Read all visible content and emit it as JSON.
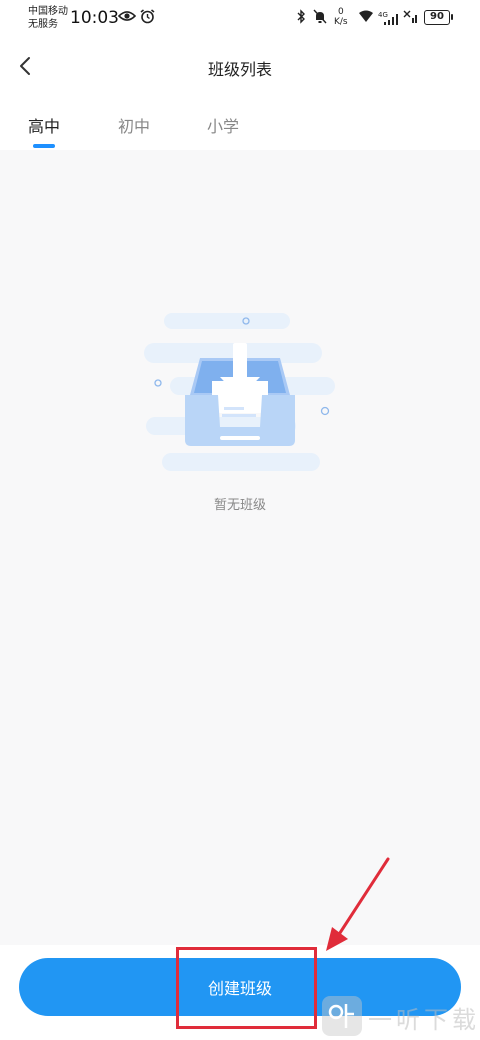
{
  "status_bar": {
    "carrier_line1": "中国移动",
    "carrier_line2": "无服务",
    "time": "10:03",
    "net_speed_value": "0",
    "net_speed_unit": "K/s",
    "network_type": "4G",
    "battery": "90"
  },
  "nav": {
    "title": "班级列表"
  },
  "tabs": [
    {
      "label": "高中",
      "active": true
    },
    {
      "label": "初中",
      "active": false
    },
    {
      "label": "小学",
      "active": false
    }
  ],
  "empty_state": {
    "message": "暂无班级"
  },
  "actions": {
    "create_label": "创建班级"
  },
  "watermark": {
    "text": "一听下载"
  },
  "colors": {
    "accent": "#2196f3",
    "annotation": "#e02c3a"
  }
}
